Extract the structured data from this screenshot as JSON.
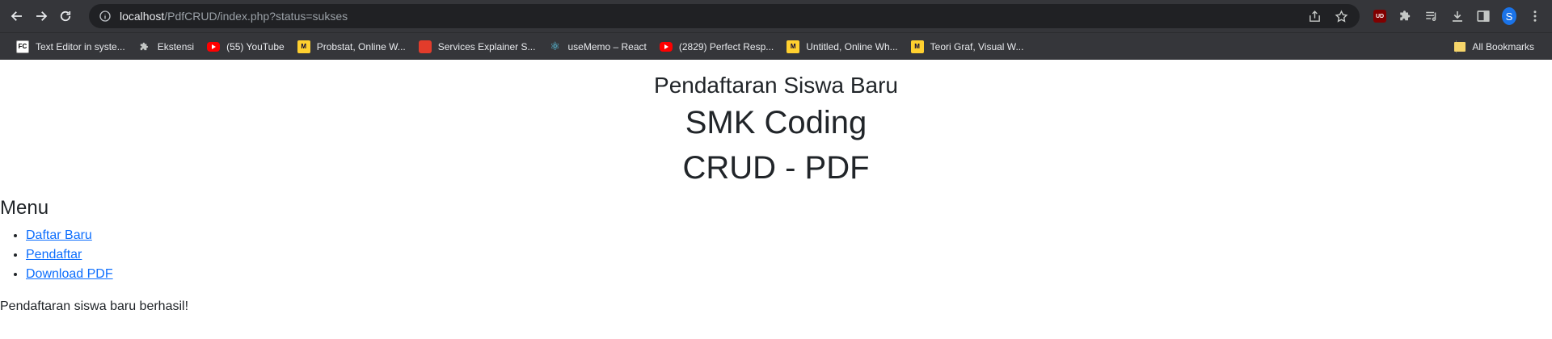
{
  "browser": {
    "url_host": "localhost",
    "url_rest": "/PdfCRUD/index.php?status=sukses",
    "profile_initial": "S",
    "ublock_label": "UD"
  },
  "bookmarks": [
    {
      "label": "Text Editor in syste...",
      "favicon": "FC"
    },
    {
      "label": "Ekstensi"
    },
    {
      "label": "(55) YouTube"
    },
    {
      "label": "Probstat, Online W..."
    },
    {
      "label": "Services Explainer S..."
    },
    {
      "label": "useMemo – React"
    },
    {
      "label": "(2829) Perfect Resp..."
    },
    {
      "label": "Untitled, Online Wh..."
    },
    {
      "label": "Teori Graf, Visual W..."
    }
  ],
  "all_bookmarks": "All Bookmarks",
  "page": {
    "subtitle": "Pendaftaran Siswa Baru",
    "title": "SMK Coding",
    "title2": "CRUD - PDF",
    "menu_heading": "Menu",
    "menu": [
      {
        "label": "Daftar Baru"
      },
      {
        "label": "Pendaftar"
      },
      {
        "label": "Download PDF"
      }
    ],
    "status_message": "Pendaftaran siswa baru berhasil!"
  }
}
